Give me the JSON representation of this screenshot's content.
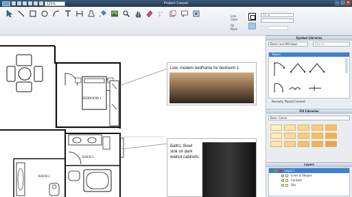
{
  "window": {
    "title": "Project Carpet",
    "zoom_value": "125%",
    "close_glyph": "✕",
    "min_glyph": "–",
    "max_glyph": "□"
  },
  "ribbon": {
    "tools": [
      "pointer-icon",
      "line-icon",
      "rectangle-icon",
      "ellipse-icon",
      "arc-icon",
      "text-icon",
      "dimension-icon",
      "stamp-icon",
      "fill-icon",
      "picture-icon",
      "zoom-icon",
      "hand-icon",
      "eraser-icon",
      "paste-icon",
      "copy-icon",
      "callout-icon",
      "symbol-icon"
    ],
    "line_color_label": "Line Color",
    "fill_style_label": "Fill Style",
    "line_weight_value": "1/2 pt",
    "dash_label": "Dash",
    "line_color": "#000000",
    "fill_color": "#9cc8e8"
  },
  "canvas": {
    "room_labels": {
      "bedroom": "BEDROOM 1",
      "bath1": "BATH 1",
      "bath2": "BATH 2"
    },
    "callout_bedroom": "Low, modern bedframe for bedroom 1",
    "callout_bath": "Bath1: Bowl sink on dark walnut cabinets."
  },
  "panel": {
    "symbol_libraries": {
      "title": "Symbol Libraries",
      "library_value": "Doors and Windows",
      "search_placeholder": "Search",
      "category": "Doors",
      "recent_label": "Recently Placed Content"
    },
    "fill_libraries": {
      "title": "Fill Libraries",
      "library_value": "Basic Colors",
      "colors": [
        "#fdf1c8",
        "#fbe4a4",
        "#f9d88a",
        "#f8cd72",
        "#f6c05c",
        "#fdecbd",
        "#fadc96",
        "#f7cc7a",
        "#f5bf62",
        "#f3b14e",
        "#fde6b0",
        "#f9d288",
        "#f5c06c",
        "#f2b056",
        "#efa243"
      ]
    },
    "layers": {
      "title": "Layers",
      "items": [
        {
          "name": "Layer 1",
          "selected": true
        },
        {
          "name": "Lines & Shapes",
          "selected": false
        },
        {
          "name": "Content",
          "selected": false
        },
        {
          "name": "Fills",
          "selected": false
        }
      ]
    }
  }
}
